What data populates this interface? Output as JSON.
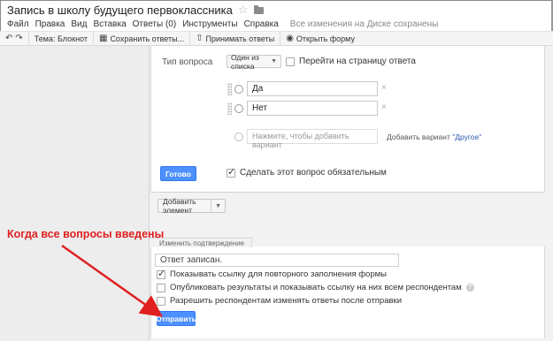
{
  "header": {
    "doc_title": "Запись в школу будущего первоклассника",
    "star_icon": "star-icon",
    "folder_icon": "folder-icon"
  },
  "menu": {
    "items": [
      "Файл",
      "Правка",
      "Вид",
      "Вставка",
      "Ответы (0)",
      "Инструменты",
      "Справка"
    ],
    "saved_status": "Все изменения на Диске сохранены"
  },
  "toolbar": {
    "undo_icon": "undo-icon",
    "redo_icon": "redo-icon",
    "theme_label": "Тема: Блокнот",
    "save_answers_label": "Сохранить ответы...",
    "accept_answers_label": "Принимать ответы",
    "open_form_label": "Открыть форму"
  },
  "question": {
    "type_label": "Тип вопроса",
    "type_value": "Один из списка",
    "go_to_page_label": "Перейти на страницу ответа",
    "go_to_page_checked": false,
    "options": [
      "Да",
      "Нет"
    ],
    "add_option_placeholder": "Нажмите, чтобы добавить вариант",
    "add_variant_prefix": "Добавить вариант ",
    "add_variant_link": "\"Другое\"",
    "remove_icon": "×",
    "done_label": "Готово",
    "required_label": "Сделать этот вопрос обязательным",
    "required_checked": true
  },
  "add_element": {
    "label": "Добавить элемент"
  },
  "confirmation": {
    "tab_label": "Изменить подтверждение",
    "message_placeholder": "Ответ записан.",
    "options": [
      {
        "label": "Показывать ссылку для повторного заполнения формы",
        "checked": true
      },
      {
        "label": "Опубликовать результаты и показывать ссылку на них всем респондентам",
        "checked": false,
        "help": "?"
      },
      {
        "label": "Разрешить респондентам изменять ответы после отправки",
        "checked": false
      }
    ],
    "submit_label": "Отправить"
  },
  "annotation": {
    "text": "Когда все вопросы введены",
    "color": "#e02020"
  },
  "colors": {
    "accent_blue": "#4d90fe",
    "link_blue": "#2a5db0"
  }
}
